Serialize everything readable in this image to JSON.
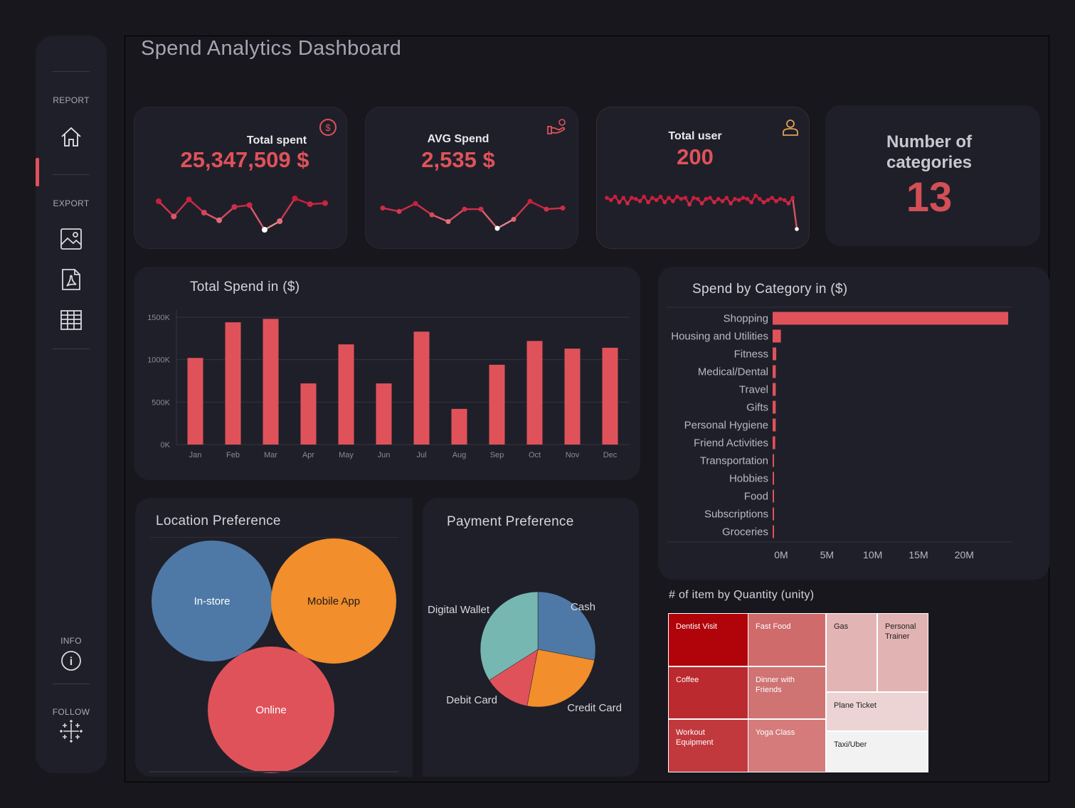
{
  "title": "Spend Analytics Dashboard",
  "rail": {
    "report_label": "REPORT",
    "export_label": "EXPORT",
    "info_label": "INFO",
    "follow_label": "FOLLOW"
  },
  "kpis": {
    "total_spent": {
      "label": "Total spent",
      "value": "25,347,509 $"
    },
    "avg_spend": {
      "label": "AVG Spend",
      "value": "2,535 $"
    },
    "total_user": {
      "label": "Total user",
      "value": "200"
    },
    "categories": {
      "label_line1": "Number of",
      "label_line2": "categories",
      "value": "13"
    }
  },
  "colors": {
    "accent": "#e0525a",
    "panel": "#1f1f29",
    "background": "#17171d",
    "blue": "#4e79a7",
    "orange": "#f28e2b",
    "teal": "#76b7b2"
  },
  "monthly_chart": {
    "title": "Total Spend in ($)",
    "chart_data": {
      "type": "bar",
      "categories": [
        "Jan",
        "Feb",
        "Mar",
        "Apr",
        "May",
        "Jun",
        "Jul",
        "Aug",
        "Sep",
        "Oct",
        "Nov",
        "Dec"
      ],
      "values": [
        1020,
        1440,
        1480,
        720,
        1180,
        720,
        1330,
        420,
        940,
        1220,
        1130,
        1140
      ],
      "unit": "K",
      "yticks": [
        "0K",
        "500K",
        "1000K",
        "1500K"
      ],
      "ylim": [
        0,
        1550
      ],
      "grid": true
    }
  },
  "category_chart": {
    "title": "Spend by Category in ($)",
    "chart_data": {
      "type": "bar",
      "orientation": "horizontal",
      "categories": [
        "Shopping",
        "Housing and Utilities",
        "Fitness",
        "Medical/Dental",
        "Travel",
        "Gifts",
        "Personal Hygiene",
        "Friend Activities",
        "Transportation",
        "Hobbies",
        "Food",
        "Subscriptions",
        "Groceries"
      ],
      "values": [
        22.8,
        0.8,
        0.35,
        0.3,
        0.3,
        0.3,
        0.3,
        0.25,
        0.1,
        0.1,
        0.08,
        0.07,
        0.07
      ],
      "unit": "M",
      "xticks": [
        "0M",
        "5M",
        "10M",
        "15M",
        "20M"
      ],
      "xlim": [
        0,
        23
      ]
    }
  },
  "location_chart": {
    "title": "Location Preference",
    "chart_data": {
      "type": "bubble",
      "categories": [
        "In-store",
        "Mobile App",
        "Online"
      ],
      "relative_size": [
        85,
        88,
        89
      ]
    }
  },
  "payment_chart": {
    "title": "Payment Preference",
    "chart_data": {
      "type": "pie",
      "categories": [
        "Cash",
        "Credit Card",
        "Debit Card",
        "Digital Wallet"
      ],
      "values": [
        28,
        25,
        13,
        34
      ]
    }
  },
  "treemap": {
    "title": "# of item by Quantity (unity)",
    "chart_data": {
      "type": "treemap",
      "categories": [
        "Dentist Visit",
        "Coffee",
        "Workout Equipment",
        "Fast Food",
        "Dinner with Friends",
        "Yoga Class",
        "Gas",
        "Personal Trainer",
        "Plane Ticket",
        "Taxi/Uber"
      ]
    }
  },
  "sparklines": {
    "total_spent": [
      1020,
      860,
      1040,
      900,
      820,
      960,
      980,
      720,
      810,
      1050,
      990,
      1000
    ],
    "avg_spend": [
      1020,
      990,
      1060,
      960,
      900,
      1010,
      1010,
      840,
      920,
      1080,
      1010,
      1020
    ],
    "total_user": [
      10,
      8,
      11,
      6,
      10,
      5,
      10,
      9,
      7,
      11,
      6,
      10,
      8,
      11,
      6,
      10,
      7,
      11,
      9,
      10,
      4,
      10,
      9,
      5,
      9,
      10,
      6,
      9,
      7,
      10,
      5,
      9,
      8,
      10,
      9,
      6,
      12,
      9,
      6,
      8,
      10,
      7,
      9,
      8,
      5,
      10,
      -18
    ]
  }
}
